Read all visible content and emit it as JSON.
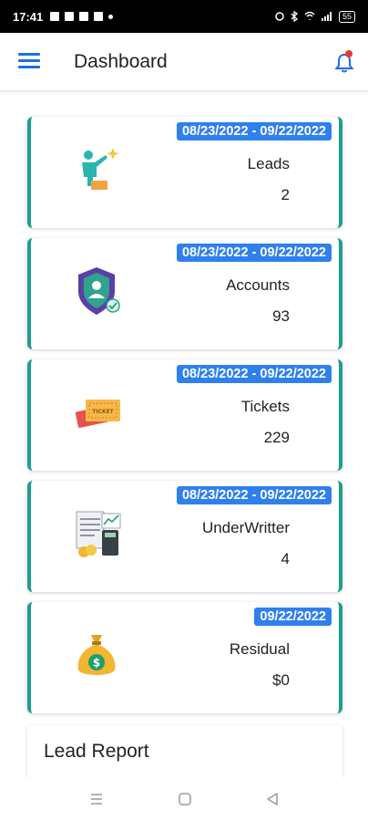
{
  "status_bar": {
    "time": "17:41",
    "signal_text": "Vo‡⁺ˡˡ",
    "battery": "55"
  },
  "app_bar": {
    "title": "Dashboard",
    "menu_icon": "hamburger-menu-icon",
    "notification_icon": "bell-icon",
    "accent_color": "#1e6ee6",
    "notification_dot_color": "#e53935"
  },
  "cards": [
    {
      "date_range": "08/23/2022 - 09/22/2022",
      "label": "Leads",
      "value": "2",
      "icon": "leads-icon"
    },
    {
      "date_range": "08/23/2022 - 09/22/2022",
      "label": "Accounts",
      "value": "93",
      "icon": "accounts-shield-icon"
    },
    {
      "date_range": "08/23/2022 - 09/22/2022",
      "label": "Tickets",
      "value": "229",
      "icon": "tickets-icon"
    },
    {
      "date_range": "08/23/2022 - 09/22/2022",
      "label": "UnderWritter",
      "value": "4",
      "icon": "underwriter-icon"
    },
    {
      "date_range": "09/22/2022",
      "label": "Residual",
      "value": "$0",
      "icon": "money-bag-icon"
    }
  ],
  "colors": {
    "card_border": "#1e9e8e",
    "badge_bg": "#2f80ed"
  },
  "lead_report": {
    "title": "Lead Report"
  },
  "nav_bar": {
    "recents_icon": "recents-icon",
    "home_icon": "home-icon",
    "back_icon": "back-icon"
  }
}
